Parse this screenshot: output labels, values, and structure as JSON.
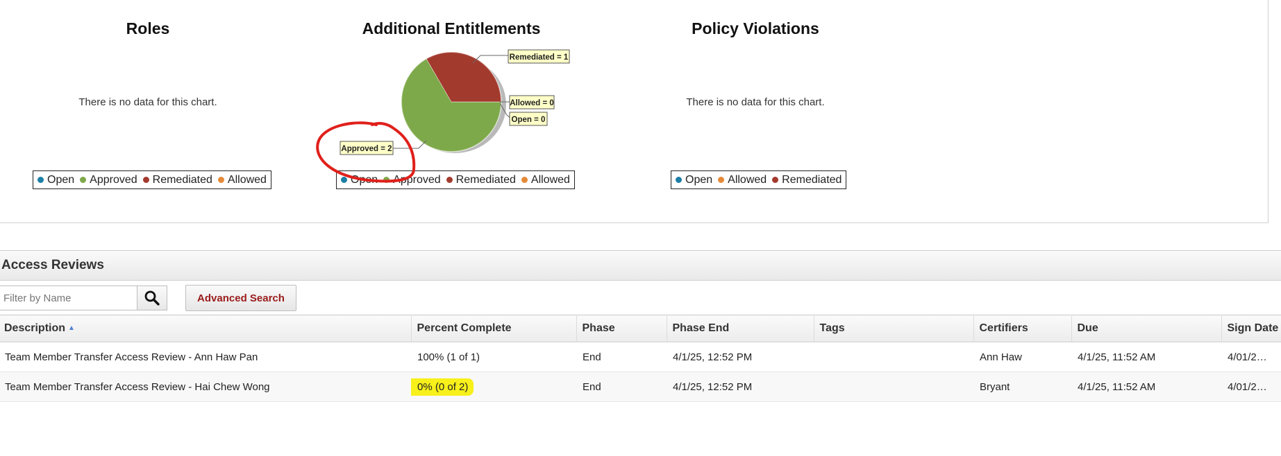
{
  "charts": {
    "roles": {
      "title": "Roles",
      "empty_message": "There is no data for this chart.",
      "legend": [
        {
          "label": "Open",
          "color": "#1d7fa6"
        },
        {
          "label": "Approved",
          "color": "#7ea94a"
        },
        {
          "label": "Remediated",
          "color": "#a33a2e"
        },
        {
          "label": "Allowed",
          "color": "#e58a39"
        }
      ]
    },
    "additional_entitlements": {
      "title": "Additional Entitlements",
      "legend": [
        {
          "label": "Open",
          "color": "#1d7fa6"
        },
        {
          "label": "Approved",
          "color": "#7ea94a"
        },
        {
          "label": "Remediated",
          "color": "#a33a2e"
        },
        {
          "label": "Allowed",
          "color": "#e58a39"
        }
      ],
      "callouts": {
        "remediated": "Remediated = 1",
        "allowed": "Allowed = 0",
        "open": "Open = 0",
        "approved": "Approved = 2"
      }
    },
    "policy_violations": {
      "title": "Policy Violations",
      "empty_message": "There is no data for this chart.",
      "legend": [
        {
          "label": "Open",
          "color": "#1d7fa6"
        },
        {
          "label": "Allowed",
          "color": "#e58a39"
        },
        {
          "label": "Remediated",
          "color": "#a33a2e"
        }
      ]
    }
  },
  "chart_data": {
    "type": "pie",
    "title": "Additional Entitlements",
    "categories": [
      "Approved",
      "Remediated",
      "Allowed",
      "Open"
    ],
    "values": [
      2,
      1,
      0,
      0
    ],
    "colors": [
      "#7ea94a",
      "#a33a2e",
      "#e58a39",
      "#1d7fa6"
    ]
  },
  "access_reviews": {
    "title": "Access Reviews",
    "filter_placeholder": "Filter by Name",
    "search_icon": "search-icon",
    "advanced_search_label": "Advanced Search",
    "columns": [
      "Description",
      "Percent Complete",
      "Phase",
      "Phase End",
      "Tags",
      "Certifiers",
      "Due",
      "Sign Date"
    ],
    "rows": [
      {
        "description": "Team Member Transfer Access Review - Ann Haw Pan",
        "percent_complete": "100% (1 of 1)",
        "phase": "End",
        "phase_end": "4/1/25, 12:52 PM",
        "tags": "",
        "certifiers": "Ann Haw",
        "due": "4/1/25, 11:52 AM",
        "sign_date": "4/01/2…"
      },
      {
        "description": "Team Member Transfer Access Review - Hai Chew Wong",
        "percent_complete": "0% (0 of 2)",
        "phase": "End",
        "phase_end": "4/1/25, 12:52 PM",
        "tags": "",
        "certifiers": "Bryant",
        "due": "4/1/25, 11:52 AM",
        "sign_date": "4/01/2…"
      }
    ]
  },
  "annotations": {
    "circle_color": "#e0201b",
    "highlight_color": "#f7f01a"
  }
}
